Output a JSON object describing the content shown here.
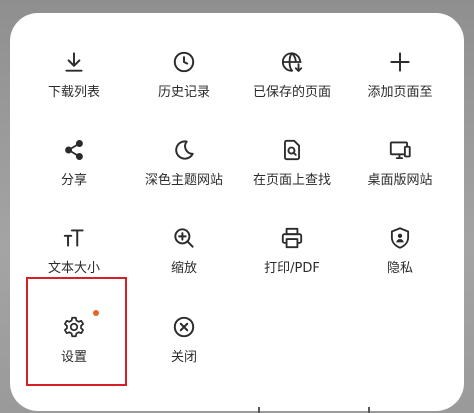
{
  "menu": {
    "items": [
      {
        "label": "下载列表",
        "icon": "download-icon"
      },
      {
        "label": "历史记录",
        "icon": "history-clock-icon"
      },
      {
        "label": "已保存的页面",
        "icon": "saved-page-globe-icon"
      },
      {
        "label": "添加页面至",
        "icon": "plus-icon"
      },
      {
        "label": "分享",
        "icon": "share-icon"
      },
      {
        "label": "深色主题网站",
        "icon": "moon-icon"
      },
      {
        "label": "在页面上查找",
        "icon": "find-in-page-icon"
      },
      {
        "label": "桌面版网站",
        "icon": "desktop-icon"
      },
      {
        "label": "文本大小",
        "icon": "text-size-icon"
      },
      {
        "label": "缩放",
        "icon": "zoom-icon"
      },
      {
        "label": "打印/PDF",
        "icon": "print-icon"
      },
      {
        "label": "隐私",
        "icon": "privacy-shield-icon"
      },
      {
        "label": "设置",
        "icon": "gear-icon"
      },
      {
        "label": "关闭",
        "icon": "close-circle-icon"
      }
    ]
  },
  "colors": {
    "icon": "#2b2b2b",
    "text": "#2b2b2b",
    "badge": "#e8652a",
    "highlight": "#d61f26",
    "panel": "#ffffff"
  }
}
